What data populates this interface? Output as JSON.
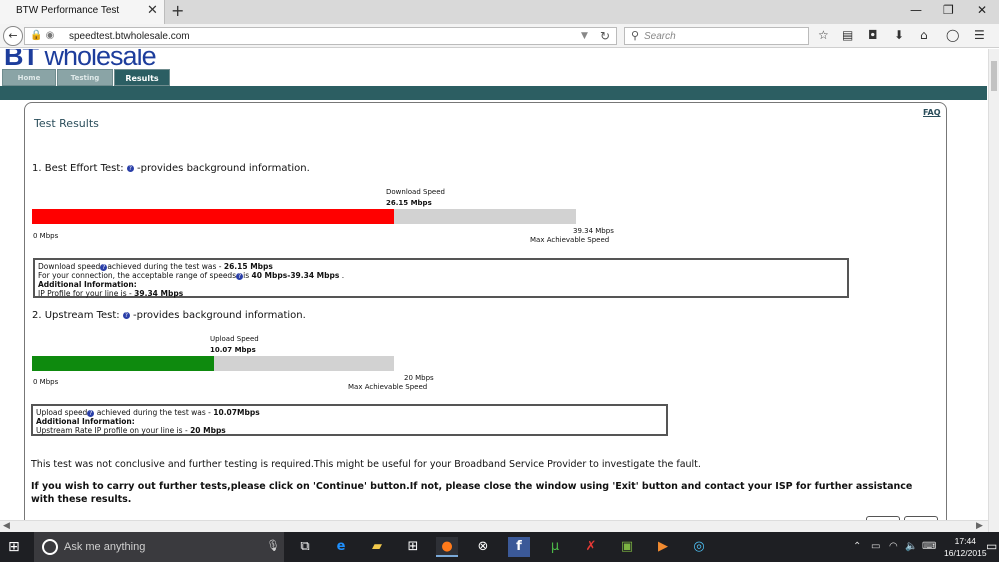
{
  "browser": {
    "tab_title": "BTW Performance Test",
    "tab_close": "✕",
    "new_tab": "+",
    "window_controls": {
      "minimize": "—",
      "restore": "❐",
      "close": "✕"
    },
    "back": "←",
    "url": "speedtest.btwholesale.com",
    "site_icons": "🔒 ◉",
    "url_dropdown": "▼",
    "reload": "↻",
    "search_placeholder": "Search",
    "toolbar_icons": [
      "star-icon",
      "reading-list-icon",
      "pocket-icon",
      "download-icon",
      "home-icon",
      "chat-icon",
      "menu-icon"
    ]
  },
  "site": {
    "logo_brand": "BT",
    "logo_rest": "wholesale",
    "nav": {
      "home": "Home",
      "testing": "Testing",
      "results": "Results"
    }
  },
  "results": {
    "title": "Test Results",
    "faq": "FAQ",
    "best_effort": {
      "heading": "1. Best Effort Test:",
      "heading_suffix": "-provides background information.",
      "speed_label": "Download Speed",
      "speed_value": "26.15 Mbps",
      "min_label": "0 Mbps",
      "max_value": "39.34 Mbps",
      "max_label": "Max Achievable Speed",
      "fill_fraction": 0.665,
      "fill_color": "#ff0000",
      "info_line1_prefix": "Download speed",
      "info_line1_mid": "achieved during the test was - ",
      "info_line1_value": "26.15 Mbps",
      "info_line2_prefix": "For your connection, the acceptable range of speeds",
      "info_line2_mid": "is ",
      "info_line2_value": "40 Mbps-39.34 Mbps",
      "info_line2_suffix": " .",
      "info_additional": "Additional Information:",
      "info_line4_prefix": "IP Profile for your line is - ",
      "info_line4_value": "39.34 Mbps"
    },
    "upstream": {
      "heading": "2. Upstream Test:",
      "heading_suffix": "-provides background information.",
      "speed_label": "Upload Speed",
      "speed_value": "10.07 Mbps",
      "min_label": "0 Mbps",
      "max_value": "20 Mbps",
      "max_label": "Max Achievable Speed",
      "fill_fraction": 0.5035,
      "fill_color": "#0e8a0e",
      "info_line1_prefix": "Upload speed",
      "info_line1_mid": " achieved during the test was - ",
      "info_line1_value": "10.07Mbps",
      "info_additional": "Additional Information:",
      "info_line3_prefix": "Upstream Rate IP profile on your line is - ",
      "info_line3_value": "20 Mbps"
    },
    "conclusion": "This test was not conclusive and further testing is required.This might be useful for your Broadband Service Provider to investigate the fault.",
    "instruction": "If you wish to carry out further tests,please click on 'Continue' button.If not, please close the window using 'Exit' button and contact your ISP for further assistance with these results."
  },
  "taskbar": {
    "search_placeholder": "Ask me anything",
    "time": "17:44",
    "date": "16/12/2015"
  }
}
